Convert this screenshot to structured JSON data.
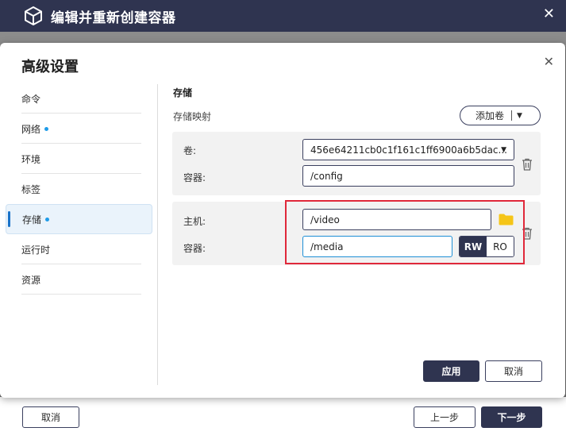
{
  "window": {
    "title": "编辑并重新创建容器"
  },
  "dialog": {
    "title": "高级设置",
    "sidebar": [
      {
        "label": "命令",
        "dot": false,
        "active": false
      },
      {
        "label": "网络",
        "dot": true,
        "active": false
      },
      {
        "label": "环境",
        "dot": false,
        "active": false
      },
      {
        "label": "标签",
        "dot": false,
        "active": false
      },
      {
        "label": "存储",
        "dot": true,
        "active": true
      },
      {
        "label": "运行时",
        "dot": false,
        "active": false
      },
      {
        "label": "资源",
        "dot": false,
        "active": false
      }
    ],
    "storage": {
      "section_title": "存储",
      "mapping_label": "存储映射",
      "add_volume_label": "添加卷",
      "volume_entry": {
        "volume_label": "卷:",
        "volume_value": "456e64211cb0c1f161c1ff6900a6b5dac...",
        "container_label": "容器:",
        "container_value": "/config"
      },
      "bind_entry": {
        "host_label": "主机:",
        "host_value": "/video",
        "container_label": "容器:",
        "container_value": "/media",
        "mode_options": [
          "RW",
          "RO"
        ],
        "mode_selected": "RW"
      }
    },
    "apply_label": "应用",
    "cancel_label": "取消"
  },
  "footer": {
    "cancel_label": "取消",
    "prev_label": "上一步",
    "next_label": "下一步"
  },
  "colors": {
    "titlebar": "#2f3450",
    "accent": "#1e9be8",
    "highlight_box": "#e0283a",
    "folder": "#f5c518"
  }
}
